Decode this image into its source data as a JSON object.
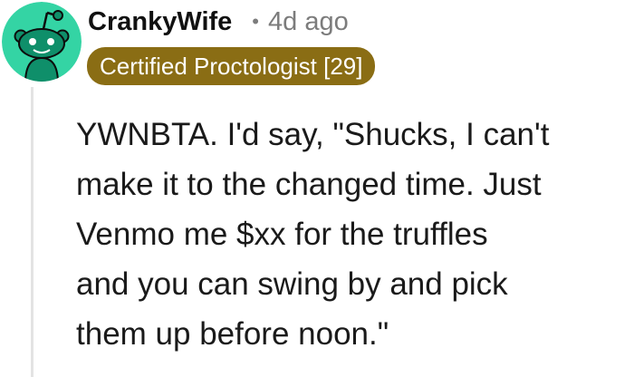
{
  "comment": {
    "username": "CrankyWife",
    "separator": "•",
    "timestamp": "4d ago",
    "flair": "Certified Proctologist [29]",
    "body_lines": [
      "YWNBTA. I'd say, \"Shucks, I can't",
      "make it to the changed time. Just",
      "Venmo me $xx for the truffles",
      "and you can swing by and pick",
      "them up before noon.\""
    ]
  },
  "colors": {
    "avatar_background": "#34d4a4",
    "flair_background": "#8a6d14",
    "thread_line": "#e3e3e3"
  },
  "icons": {
    "avatar": "reddit-snoo-avatar-icon"
  }
}
